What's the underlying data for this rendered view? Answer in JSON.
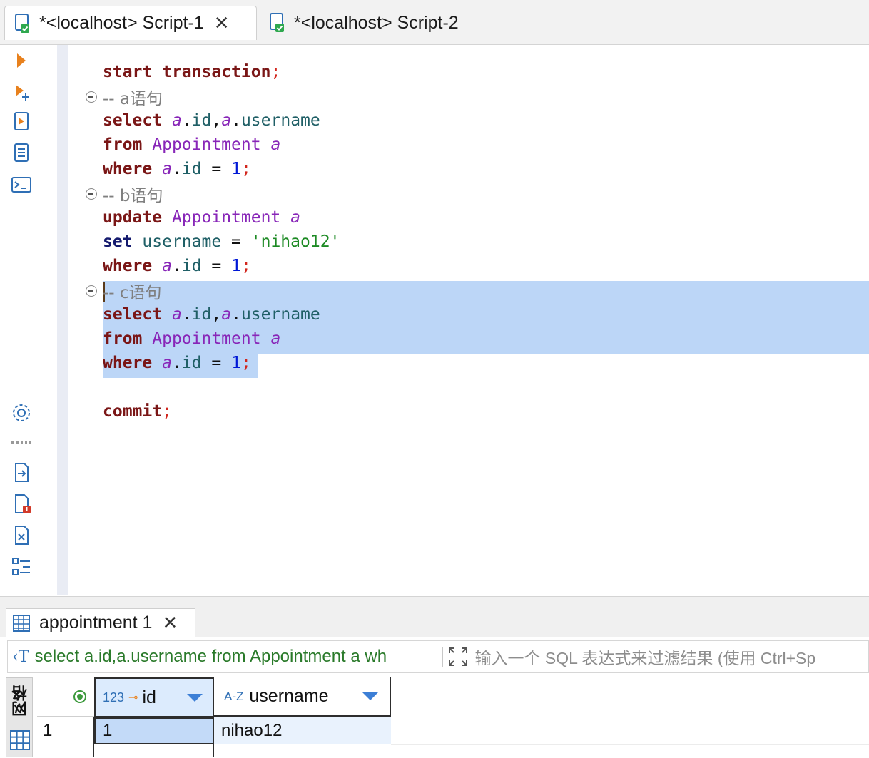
{
  "tabs": [
    {
      "label": "*<localhost> Script-1",
      "active": true
    },
    {
      "label": "*<localhost> Script-2",
      "active": false
    }
  ],
  "editor": {
    "comments": [
      "-- a语句",
      "-- b语句",
      "-- c语句"
    ],
    "keywords": {
      "start": "start",
      "transaction": "transaction",
      "select": "select",
      "from": "from",
      "where": "where",
      "update": "update",
      "set": "set",
      "commit": "commit"
    },
    "table_name": "Appointment",
    "alias": "a",
    "columns": {
      "id": "id",
      "username": "username"
    },
    "value_id": "1",
    "value_username": "'nihao12'"
  },
  "result": {
    "tab_label": "appointment 1",
    "query_text": "select a.id,a.username from Appointment a wh",
    "filter_placeholder": "输入一个 SQL 表达式来过滤结果 (使用 Ctrl+Sp",
    "side_tab_label": "网格",
    "columns": [
      {
        "type_label": "123",
        "name": "id"
      },
      {
        "type_label": "A-Z",
        "name": "username"
      }
    ],
    "rows": [
      {
        "row_num": "1",
        "id": "1",
        "username": "nihao12"
      }
    ]
  },
  "colors": {
    "keyword": "#7a1616",
    "object": "#8826b8",
    "column": "#1f5f66",
    "number": "#0018d6",
    "string": "#1d8a24",
    "selection": "#bcd6f7"
  }
}
